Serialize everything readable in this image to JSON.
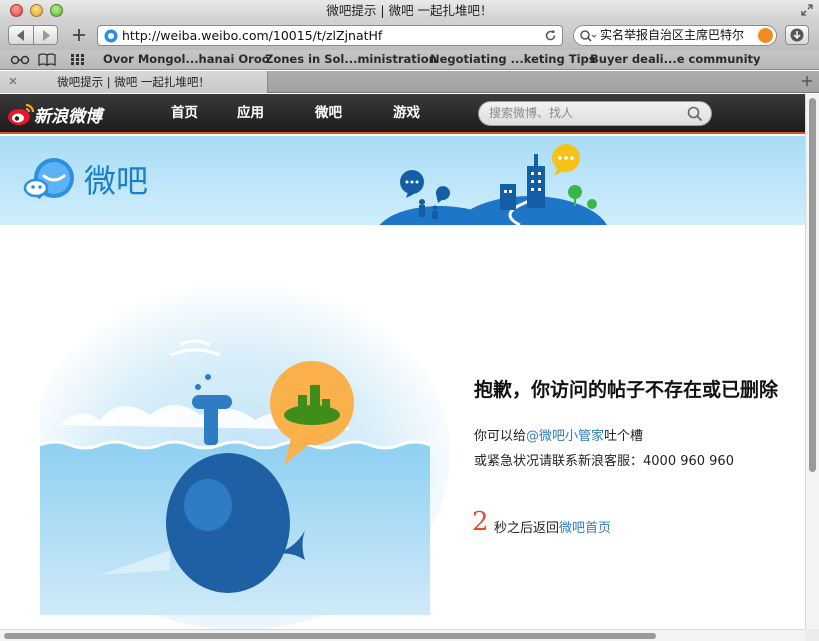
{
  "browser": {
    "window_title": "微吧提示 | 微吧 一起扎堆吧！",
    "url": "http://weiba.weibo.com/10015/t/zlZjnatHf",
    "search_query": "实名举报自治区主席巴特尔",
    "bookmarks": [
      "Ovor Mongol...hanai Oroo",
      "Zones in Sol...ministration",
      "Negotiating ...keting Tips",
      "Buyer deali...e community"
    ],
    "tab_title": "微吧提示 | 微吧 一起扎堆吧！"
  },
  "weibo_nav": {
    "brand": "新浪微博",
    "links": [
      "首页",
      "应用",
      "微吧",
      "游戏"
    ],
    "search_placeholder": "搜索微博、找人"
  },
  "banner": {
    "title": "微吧"
  },
  "message": {
    "title": "抱歉，你访问的帖子不存在或已删除",
    "line1_prefix": "你可以给",
    "line1_link": "@微吧小管家",
    "line1_suffix": "吐个槽",
    "line2": "或紧急状况请联系新浪客服：4000 960 960",
    "countdown": "2",
    "back_prefix": "秒之后返回",
    "back_link": "微吧首页"
  },
  "colors": {
    "accent_orange": "#e3501b",
    "link_blue": "#2f7cc0",
    "countdown_red": "#e8463a",
    "banner_blue": "#a9dcf6"
  }
}
